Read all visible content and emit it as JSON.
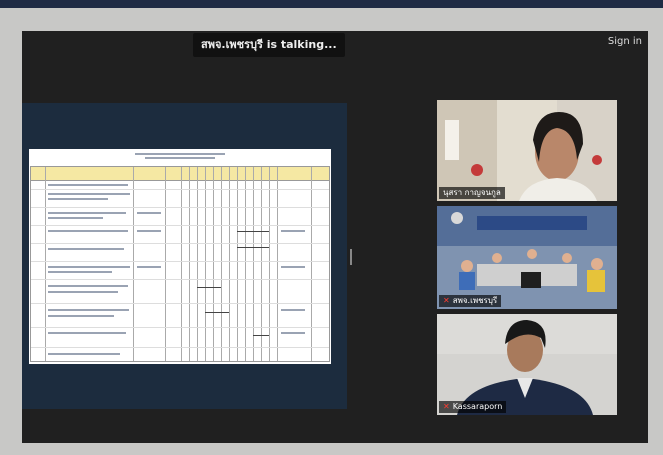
{
  "meeting": {
    "talking_indicator": "สพจ.เพชรบุรี is  talking...",
    "sign_in_label": "Sign in"
  },
  "participants": [
    {
      "name": "นุสรา กาญจนกูล",
      "muted": false
    },
    {
      "name": "สพจ.เพชรบุรี",
      "muted": true
    },
    {
      "name": "Kassaraporn",
      "muted": true
    }
  ],
  "colors": {
    "background": "#c8c8c6",
    "stage": "#202020",
    "share_area": "#1c2c3e",
    "muted_icon": "#ff3b30"
  }
}
